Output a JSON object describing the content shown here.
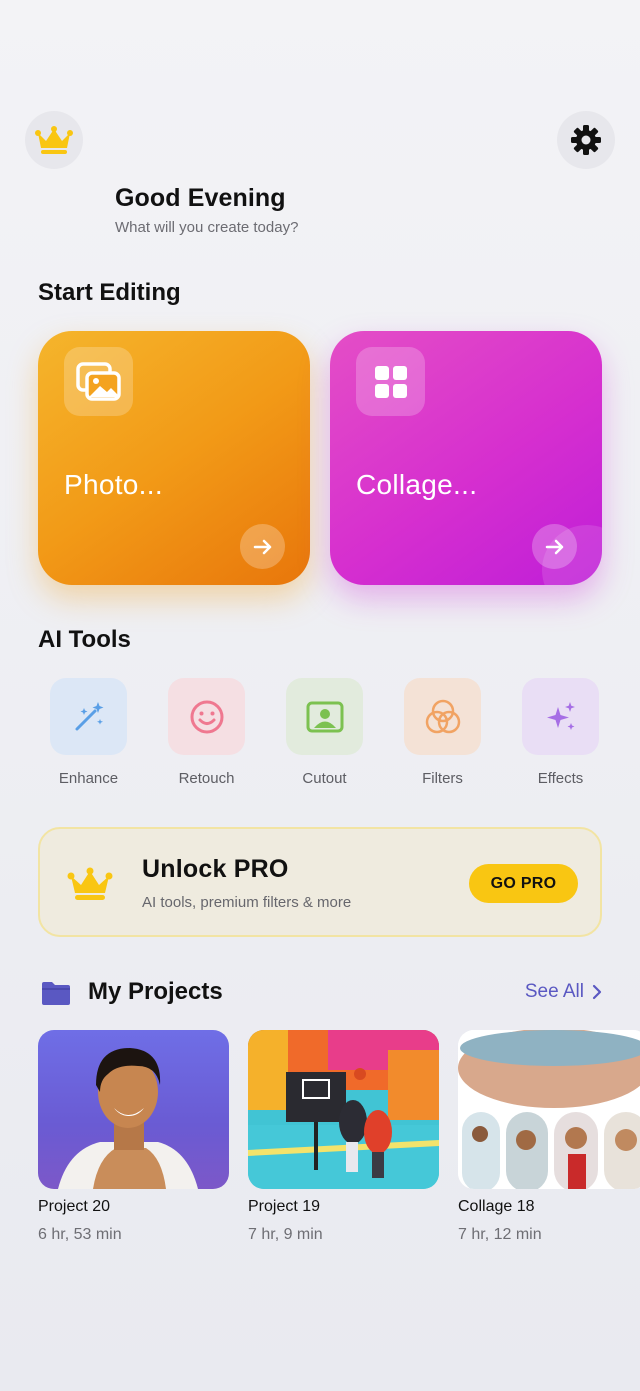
{
  "header": {
    "title": "Good Evening",
    "subtitle": "What will you create today?"
  },
  "start_editing": {
    "title": "Start Editing",
    "cards": [
      {
        "label": "Photo...",
        "icon": "photos-icon",
        "color": "#f29a17"
      },
      {
        "label": "Collage...",
        "icon": "grid-icon",
        "color": "#d62fcf"
      }
    ]
  },
  "ai_tools": {
    "title": "AI Tools",
    "items": [
      {
        "label": "Enhance",
        "icon": "magic-wand-icon",
        "bg": "#dce7f6",
        "color": "#5a9fe6"
      },
      {
        "label": "Retouch",
        "icon": "smiley-icon",
        "bg": "#f5dfe3",
        "color": "#ef7890"
      },
      {
        "label": "Cutout",
        "icon": "cutout-person-icon",
        "bg": "#e2ebdd",
        "color": "#7cc150"
      },
      {
        "label": "Filters",
        "icon": "filters-circles-icon",
        "bg": "#f4e2d6",
        "color": "#f1a363"
      },
      {
        "label": "Effects",
        "icon": "sparkles-icon",
        "bg": "#e9def5",
        "color": "#a66ee5"
      }
    ]
  },
  "pro": {
    "title": "Unlock PRO",
    "subtitle": "AI tools, premium filters & more",
    "button": "GO PRO"
  },
  "projects": {
    "title": "My Projects",
    "see_all": "See All",
    "items": [
      {
        "name": "Project 20",
        "time": "6 hr, 53 min"
      },
      {
        "name": "Project 19",
        "time": "7 hr, 9 min"
      },
      {
        "name": "Collage 18",
        "time": "7 hr, 12 min"
      }
    ]
  },
  "colors": {
    "accent": "#5a58c2",
    "pro_yellow": "#f9c612",
    "crown": "#f9c612"
  }
}
